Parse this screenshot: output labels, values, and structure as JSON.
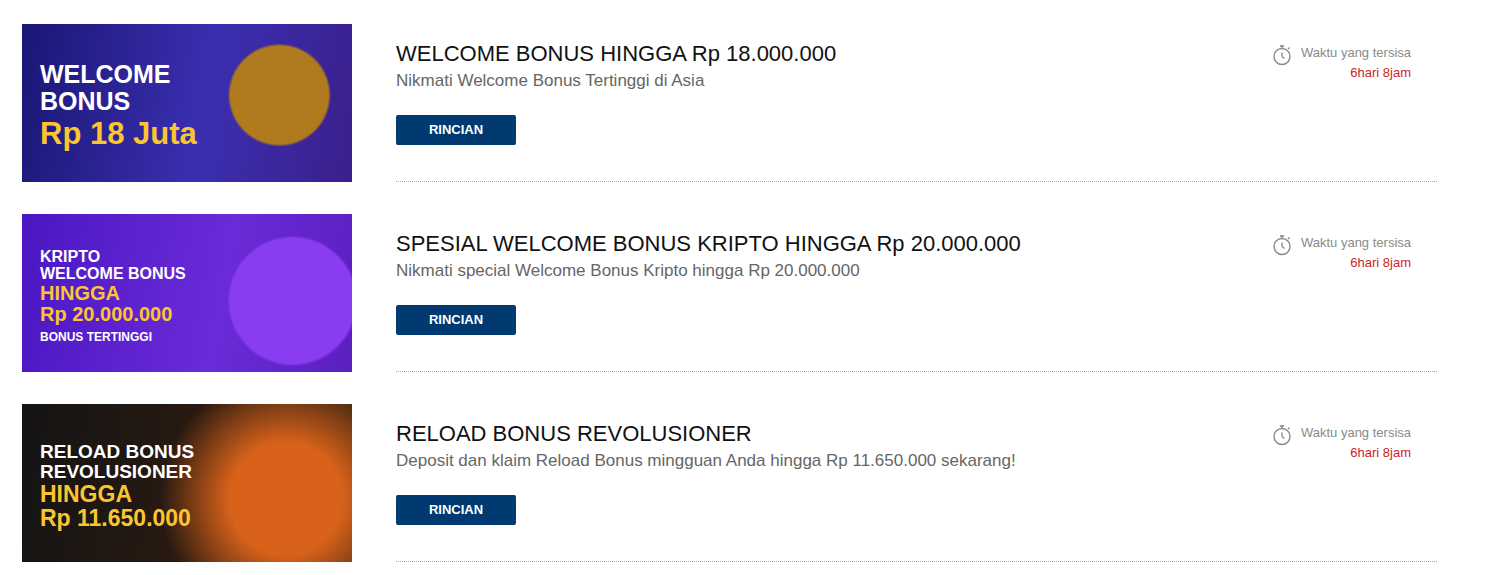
{
  "promotions": [
    {
      "banner": {
        "lines": [
          {
            "text": "WELCOME",
            "kind": "head"
          },
          {
            "text": "BONUS",
            "kind": "head"
          },
          {
            "text": "Rp 18 Juta",
            "kind": "accent"
          }
        ]
      },
      "title": "WELCOME BONUS HINGGA Rp 18.000.000",
      "subtitle": "Nikmati Welcome Bonus Tertinggi di Asia",
      "button": "RINCIAN",
      "timer": {
        "label": "Waktu yang tersisa",
        "value": "6hari 8jam"
      }
    },
    {
      "banner": {
        "lines": [
          {
            "text": "KRIPTO",
            "kind": "head"
          },
          {
            "text": "WELCOME BONUS",
            "kind": "head"
          },
          {
            "text": "HINGGA",
            "kind": "accent"
          },
          {
            "text": "Rp 20.000.000",
            "kind": "accent"
          },
          {
            "text": "BONUS TERTINGGI",
            "kind": "note"
          }
        ]
      },
      "title": "SPESIAL WELCOME BONUS KRIPTO HINGGA Rp 20.000.000",
      "subtitle": "Nikmati special Welcome Bonus Kripto hingga Rp 20.000.000",
      "button": "RINCIAN",
      "timer": {
        "label": "Waktu yang tersisa",
        "value": "6hari 8jam"
      }
    },
    {
      "banner": {
        "lines": [
          {
            "text": "RELOAD BONUS",
            "kind": "head"
          },
          {
            "text": "REVOLUSIONER",
            "kind": "head"
          },
          {
            "text": "HINGGA",
            "kind": "accent"
          },
          {
            "text": "Rp 11.650.000",
            "kind": "accent"
          }
        ]
      },
      "title": "RELOAD BONUS REVOLUSIONER",
      "subtitle": "Deposit dan klaim Reload Bonus mingguan Anda hingga Rp 11.650.000 sekarang!",
      "button": "RINCIAN",
      "timer": {
        "label": "Waktu yang tersisa",
        "value": "6hari 8jam"
      }
    }
  ]
}
